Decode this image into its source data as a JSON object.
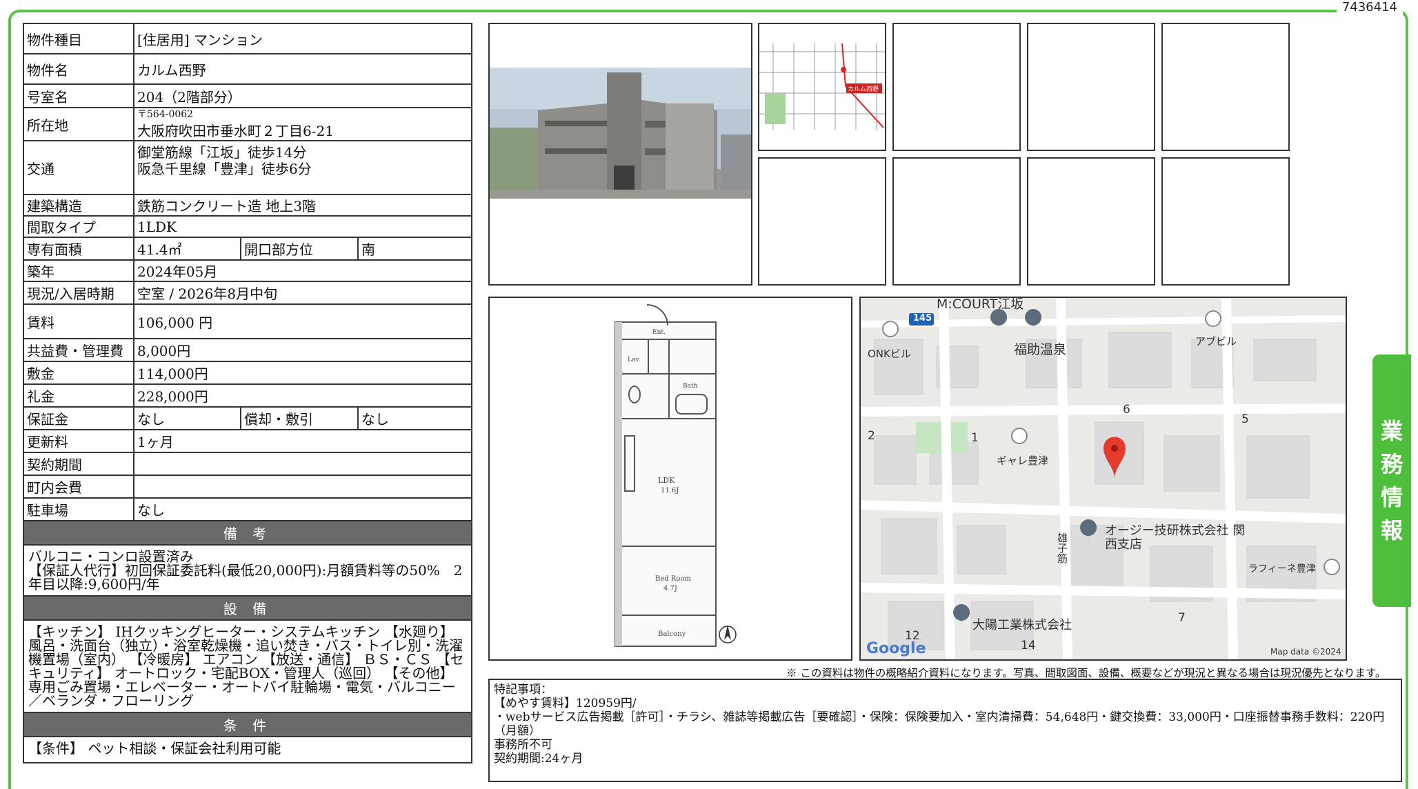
{
  "doc_id": "7436414",
  "side_tab": [
    "業",
    "務",
    "情",
    "報"
  ],
  "property": {
    "type_label": "物件種目",
    "type_value": "[住居用] マンション",
    "name_label": "物件名",
    "name_value": "カルム西野",
    "room_label": "号室名",
    "room_value": "204（2階部分）",
    "address_label": "所在地",
    "zip": "〒564-0062",
    "address": "大阪府吹田市垂水町２丁目6-21",
    "transit_label": "交通",
    "transit_1": "御堂筋線「江坂」徒歩14分",
    "transit_2": "阪急千里線「豊津」徒歩6分",
    "structure_label": "建築構造",
    "structure_value": "鉄筋コンクリート造 地上3階",
    "layout_label": "間取タイプ",
    "layout_value": "1LDK",
    "area_label": "専有面積",
    "area_value": "41.4㎡",
    "opening_label": "開口部方位",
    "opening_value": "南",
    "built_label": "築年",
    "built_value": "2024年05月",
    "status_label": "現況/入居時期",
    "status_value": "空室 / 2026年8月中旬",
    "rent_label": "賃料",
    "rent_value": "106,000 円",
    "fee_label": "共益費・管理費",
    "fee_value": "8,000円",
    "deposit_label": "敷金",
    "deposit_value": "114,000円",
    "key_money_label": "礼金",
    "key_money_value": "228,000円",
    "guarantee_label": "保証金",
    "guarantee_value": "なし",
    "amort_label": "償却・敷引",
    "amort_value": "なし",
    "renewal_label": "更新料",
    "renewal_value": "1ヶ月",
    "contract_label": "契約期間",
    "contract_value": "",
    "assoc_label": "町内会費",
    "assoc_value": "",
    "parking_label": "駐車場",
    "parking_value": "なし"
  },
  "remarks_section": {
    "title": "備 考",
    "body": "バルコニ・コンロ設置済み\n【保証人代行】初回保証委託料(最低20,000円):月額賃料等の50%　2年目以降:9,600円/年"
  },
  "equipment_section": {
    "title": "設 備",
    "body": "【キッチン】 IHクッキングヒーター・システムキッチン 【水廻り】 風呂・洗面台（独立）・浴室乾燥機・追い焚き・バス・トイレ別・洗濯機置場（室内） 【冷暖房】 エアコン 【放送・通信】 ＢＳ・ＣＳ 【セキュリティ】 オートロック・宅配BOX・管理人（巡回） 【その他】 専用ごみ置場・エレベーター・オートバイ駐輪場・電気・バルコニー／ベランダ・フローリング"
  },
  "conditions_section": {
    "title": "条 件",
    "body": "【条件】 ペット相談・保証会社利用可能"
  },
  "mini_map": {
    "label": "カルム西野"
  },
  "floorplan": {
    "ldk": "LDK",
    "ldk_size": "11.6J",
    "bed": "Bed Room",
    "bed_size": "4.7J",
    "balcony": "Balcony",
    "bath": "Bath",
    "ent": "Ent.",
    "wc": "Lav."
  },
  "map": {
    "labels": [
      "M:COURT江坂",
      "145",
      "福助温泉",
      "アブビル",
      "ONKビル",
      "ギャレ豊津",
      "オージー技研株式会社 関西支店",
      "ラフィーネ豊津",
      "大陽工業株式会社",
      "雄子筋",
      "2",
      "1",
      "6",
      "5",
      "7",
      "12",
      "14"
    ],
    "google": "Google",
    "attribution": "Map data ©2024",
    "pin_color": "#e33b2e"
  },
  "disclaimer": "※ この資料は物件の概略紹介資料になります。写真、間取図面、設備、概要などが現況と異なる場合は現況優先となります。",
  "special_notes": {
    "line1": "特記事項：",
    "line2": "【めやす賃料】120959円/",
    "line3": "・webサービス広告掲載［許可］・チラシ、雑誌等掲載広告［要確認］・保険：保険要加入・室内清掃費：54,648円・鍵交換費：33,000円・口座振替事務手数料：220円（月額）",
    "line4": "事務所不可",
    "line5": "契約期間:24ヶ月"
  }
}
